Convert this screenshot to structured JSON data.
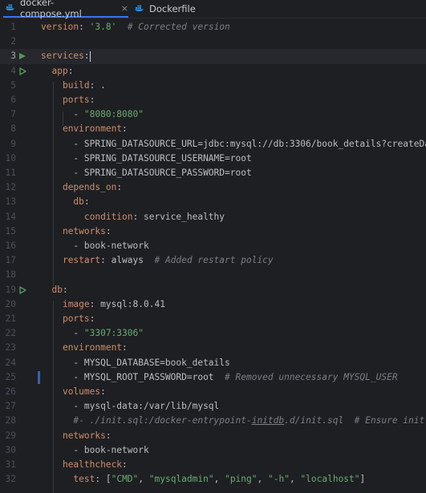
{
  "tabs": [
    {
      "label": "docker-compose.yml",
      "active": true,
      "icon": "docker-icon"
    },
    {
      "label": "Dockerfile",
      "active": false,
      "icon": "docker-icon"
    }
  ],
  "tab_close_glyph": "×",
  "colors": {
    "key": "#cf8e6d",
    "string": "#6aab73",
    "comment": "#7a7e85",
    "text": "#bcbec4",
    "accent": "#3574f0"
  },
  "editor": {
    "current_line": 3,
    "lines": [
      {
        "n": "1",
        "t": [
          {
            "k": "version"
          },
          {
            "p": ": "
          },
          {
            "s": "'3.8'"
          },
          {
            "p": "  "
          },
          {
            "c": "# Corrected version"
          }
        ]
      },
      {
        "n": "2",
        "t": []
      },
      {
        "n": "3",
        "t": [
          {
            "k": "services"
          },
          {
            "p": ":"
          }
        ],
        "run": true,
        "caret": true
      },
      {
        "n": "4",
        "t": [
          {
            "p": "  "
          },
          {
            "k": "app"
          },
          {
            "p": ":"
          }
        ],
        "run_outline": true
      },
      {
        "n": "5",
        "t": [
          {
            "p": "    "
          },
          {
            "k": "build"
          },
          {
            "p": ": ."
          }
        ]
      },
      {
        "n": "6",
        "t": [
          {
            "p": "    "
          },
          {
            "k": "ports"
          },
          {
            "p": ":"
          }
        ]
      },
      {
        "n": "7",
        "t": [
          {
            "p": "      - "
          },
          {
            "s": "\"8080:8080\""
          }
        ]
      },
      {
        "n": "8",
        "t": [
          {
            "p": "    "
          },
          {
            "k": "environment"
          },
          {
            "p": ":"
          }
        ]
      },
      {
        "n": "9",
        "t": [
          {
            "p": "      - SPRING_DATASOURCE_URL=jdbc:mysql://db:3306/book_details?createDa"
          }
        ]
      },
      {
        "n": "10",
        "t": [
          {
            "p": "      - SPRING_DATASOURCE_USERNAME=root"
          }
        ]
      },
      {
        "n": "11",
        "t": [
          {
            "p": "      - SPRING_DATASOURCE_PASSWORD=root"
          }
        ]
      },
      {
        "n": "12",
        "t": [
          {
            "p": "    "
          },
          {
            "k": "depends_on"
          },
          {
            "p": ":"
          }
        ]
      },
      {
        "n": "13",
        "t": [
          {
            "p": "      "
          },
          {
            "k": "db"
          },
          {
            "p": ":"
          }
        ]
      },
      {
        "n": "14",
        "t": [
          {
            "p": "        "
          },
          {
            "k": "condition"
          },
          {
            "p": ": service_healthy"
          }
        ]
      },
      {
        "n": "15",
        "t": [
          {
            "p": "    "
          },
          {
            "k": "networks"
          },
          {
            "p": ":"
          }
        ]
      },
      {
        "n": "16",
        "t": [
          {
            "p": "      - book-network"
          }
        ]
      },
      {
        "n": "17",
        "t": [
          {
            "p": "    "
          },
          {
            "k": "restart"
          },
          {
            "p": ": always  "
          },
          {
            "c": "# Added restart policy"
          }
        ]
      },
      {
        "n": "18",
        "t": []
      },
      {
        "n": "19",
        "t": [
          {
            "p": "  "
          },
          {
            "k": "db"
          },
          {
            "p": ":"
          }
        ],
        "run_outline": true
      },
      {
        "n": "20",
        "t": [
          {
            "p": "    "
          },
          {
            "k": "image"
          },
          {
            "p": ": mysql:8.0.41"
          }
        ]
      },
      {
        "n": "21",
        "t": [
          {
            "p": "    "
          },
          {
            "k": "ports"
          },
          {
            "p": ":"
          }
        ]
      },
      {
        "n": "22",
        "t": [
          {
            "p": "      - "
          },
          {
            "s": "\"3307:3306\""
          }
        ]
      },
      {
        "n": "23",
        "t": [
          {
            "p": "    "
          },
          {
            "k": "environment"
          },
          {
            "p": ":"
          }
        ]
      },
      {
        "n": "24",
        "t": [
          {
            "p": "      - MYSQL_DATABASE=book_details"
          }
        ]
      },
      {
        "n": "25",
        "t": [
          {
            "p": "      - MYSQL_ROOT_PASSWORD=root  "
          },
          {
            "c": "# Removed unnecessary MYSQL_USER"
          }
        ],
        "changed": true
      },
      {
        "n": "26",
        "t": [
          {
            "p": "    "
          },
          {
            "k": "volumes"
          },
          {
            "p": ":"
          }
        ]
      },
      {
        "n": "27",
        "t": [
          {
            "p": "      - mysql-data:/var/lib/mysql"
          }
        ]
      },
      {
        "n": "28",
        "t": [
          {
            "p": "      "
          },
          {
            "c": "#- ./init.sql:/docker-entrypoint-"
          },
          {
            "cu": "initdb"
          },
          {
            "c": ".d/init.sql  # Ensure init."
          }
        ]
      },
      {
        "n": "29",
        "t": [
          {
            "p": "    "
          },
          {
            "k": "networks"
          },
          {
            "p": ":"
          }
        ]
      },
      {
        "n": "30",
        "t": [
          {
            "p": "      - book-network"
          }
        ]
      },
      {
        "n": "31",
        "t": [
          {
            "p": "    "
          },
          {
            "k": "healthcheck"
          },
          {
            "p": ":"
          }
        ]
      },
      {
        "n": "32",
        "t": [
          {
            "p": "      "
          },
          {
            "k": "test"
          },
          {
            "p": ": ["
          },
          {
            "s": "\"CMD\""
          },
          {
            "p": ", "
          },
          {
            "s": "\"mysqladmin\""
          },
          {
            "p": ", "
          },
          {
            "s": "\"ping\""
          },
          {
            "p": ", "
          },
          {
            "s": "\"-h\""
          },
          {
            "p": ", "
          },
          {
            "s": "\"localhost\""
          },
          {
            "p": "]"
          }
        ]
      }
    ]
  }
}
